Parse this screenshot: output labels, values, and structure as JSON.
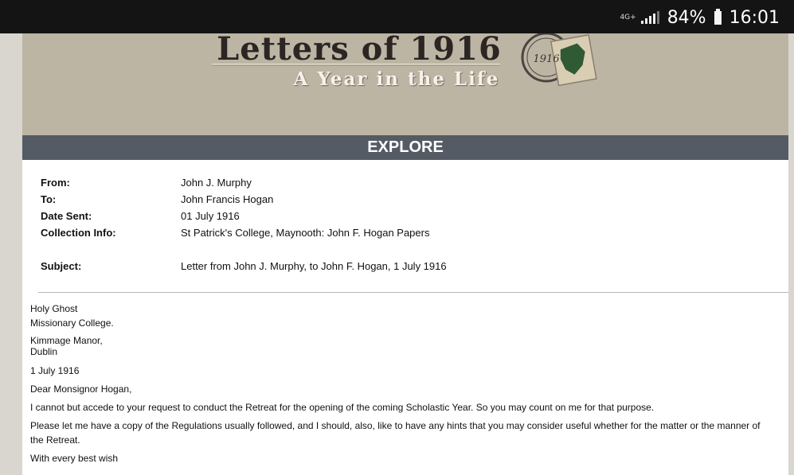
{
  "status": {
    "network": "4G+",
    "battery_pct": "84%",
    "time": "16:01"
  },
  "header": {
    "title": "Letters of 1916",
    "subtitle": "A Year in the Life",
    "stamp_text": "1916"
  },
  "nav": {
    "section": "EXPLORE"
  },
  "meta": {
    "from_label": "From:",
    "from_value": "John J. Murphy",
    "to_label": "To:",
    "to_value": "John Francis Hogan",
    "date_label": "Date Sent:",
    "date_value": "01 July 1916",
    "collection_label": "Collection Info:",
    "collection_value": "St Patrick's College, Maynooth: John F. Hogan Papers",
    "subject_label": "Subject:",
    "subject_value": "Letter from John J. Murphy, to John F. Hogan, 1 July 1916"
  },
  "letter": {
    "line1": "Holy Ghost",
    "line2": "Missionary College.",
    "line3": "Kimmage Manor,",
    "line4": "Dublin",
    "date": "1 July 1916",
    "greeting": "Dear Monsignor Hogan,",
    "para1": "I cannot but accede to your request to conduct the Retreat for the opening of the coming Scholastic Year. So you may count on me for that purpose.",
    "para2": "Please let me have a copy of the Regulations usually followed, and I should, also, like to have any hints that you may consider useful whether for the matter or the manner of the Retreat.",
    "closing": "With every best wish"
  }
}
